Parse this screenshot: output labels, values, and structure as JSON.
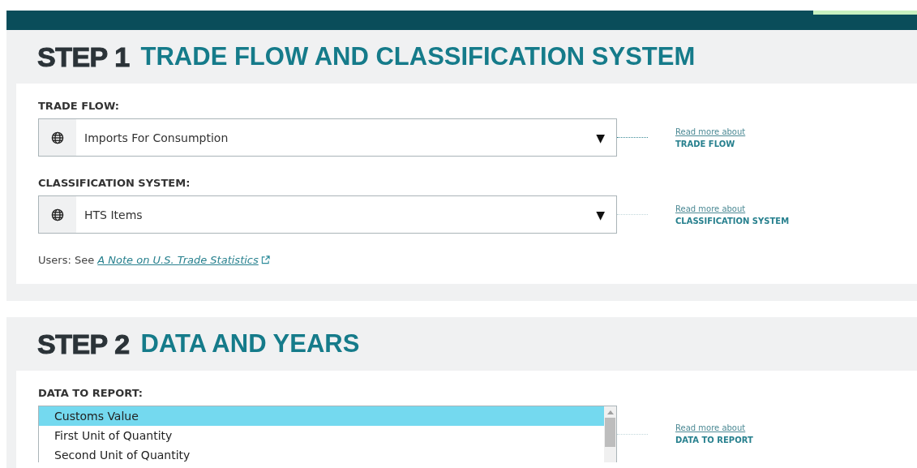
{
  "steps": [
    {
      "number": "STEP 1",
      "title": "TRADE FLOW AND CLASSIFICATION SYSTEM",
      "fields": [
        {
          "kind": "select",
          "label": "TRADE FLOW:",
          "value": "Imports For Consumption",
          "arrow": "▼",
          "link": {
            "prefix": "Read more about",
            "topic": "TRADE FLOW"
          }
        },
        {
          "kind": "select",
          "label": "CLASSIFICATION SYSTEM:",
          "value": "HTS Items",
          "arrow": "▼",
          "link": {
            "prefix": "Read more about",
            "topic": "CLASSIFICATION SYSTEM"
          }
        }
      ],
      "note": {
        "text": "Users: See ",
        "link": "A Note on U.S. Trade Statistics"
      }
    },
    {
      "number": "STEP 2",
      "title": "DATA AND YEARS",
      "fields": [
        {
          "kind": "listbox",
          "label": "DATA TO REPORT:",
          "options": [
            {
              "label": "Customs Value",
              "selected": true
            },
            {
              "label": "First Unit of Quantity",
              "selected": false
            },
            {
              "label": "Second Unit of Quantity",
              "selected": false
            }
          ],
          "link": {
            "prefix": "Read more about",
            "topic": "DATA TO REPORT"
          }
        }
      ]
    }
  ]
}
